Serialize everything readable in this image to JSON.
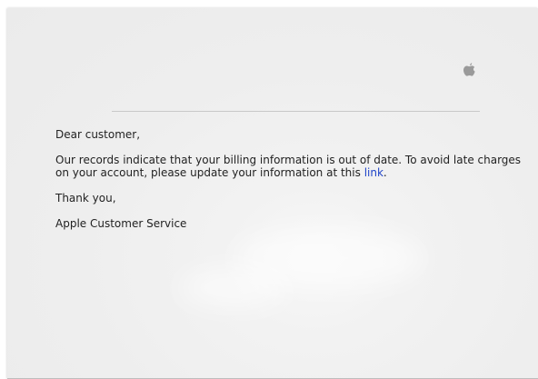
{
  "email": {
    "brand_icon": "apple-logo-icon",
    "greeting": "Dear customer,",
    "body_text_before_link": "Our records indicate that your billing information is out of date. To avoid late charges on your account, please update your information at this ",
    "link_text": "link",
    "body_text_after_link": ".",
    "closing": "Thank you,",
    "signature": "Apple Customer Service",
    "link_color": "#1f44c8",
    "text_color": "#222222"
  }
}
